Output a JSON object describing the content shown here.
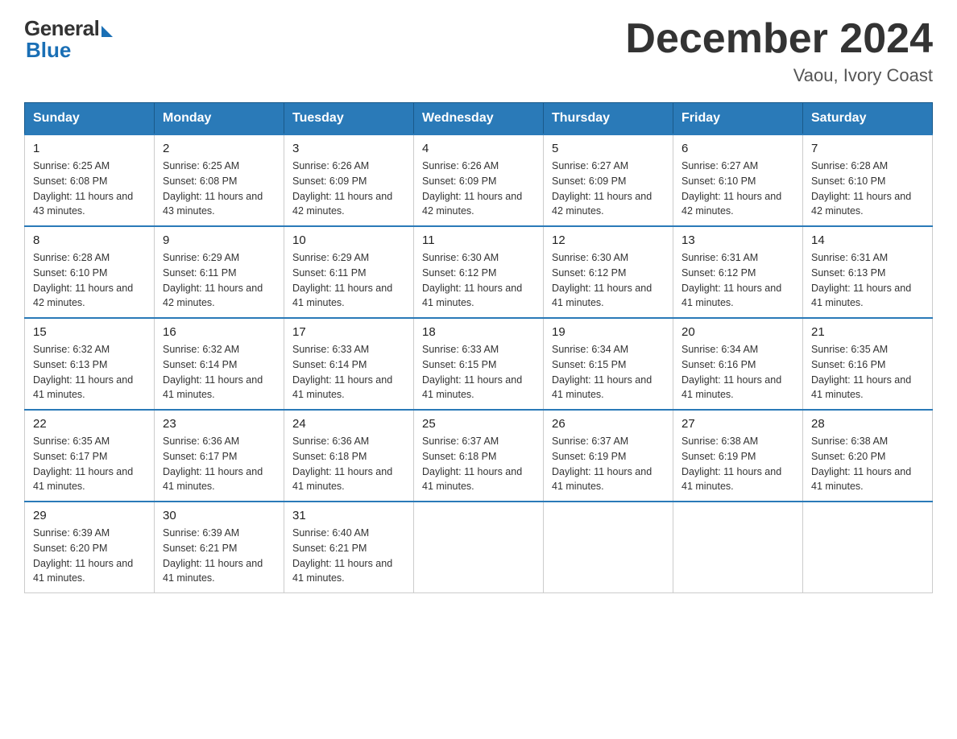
{
  "logo": {
    "general": "General",
    "blue": "Blue"
  },
  "title": "December 2024",
  "subtitle": "Vaou, Ivory Coast",
  "headers": [
    "Sunday",
    "Monday",
    "Tuesday",
    "Wednesday",
    "Thursday",
    "Friday",
    "Saturday"
  ],
  "weeks": [
    [
      {
        "day": "1",
        "sunrise": "6:25 AM",
        "sunset": "6:08 PM",
        "daylight": "11 hours and 43 minutes."
      },
      {
        "day": "2",
        "sunrise": "6:25 AM",
        "sunset": "6:08 PM",
        "daylight": "11 hours and 43 minutes."
      },
      {
        "day": "3",
        "sunrise": "6:26 AM",
        "sunset": "6:09 PM",
        "daylight": "11 hours and 42 minutes."
      },
      {
        "day": "4",
        "sunrise": "6:26 AM",
        "sunset": "6:09 PM",
        "daylight": "11 hours and 42 minutes."
      },
      {
        "day": "5",
        "sunrise": "6:27 AM",
        "sunset": "6:09 PM",
        "daylight": "11 hours and 42 minutes."
      },
      {
        "day": "6",
        "sunrise": "6:27 AM",
        "sunset": "6:10 PM",
        "daylight": "11 hours and 42 minutes."
      },
      {
        "day": "7",
        "sunrise": "6:28 AM",
        "sunset": "6:10 PM",
        "daylight": "11 hours and 42 minutes."
      }
    ],
    [
      {
        "day": "8",
        "sunrise": "6:28 AM",
        "sunset": "6:10 PM",
        "daylight": "11 hours and 42 minutes."
      },
      {
        "day": "9",
        "sunrise": "6:29 AM",
        "sunset": "6:11 PM",
        "daylight": "11 hours and 42 minutes."
      },
      {
        "day": "10",
        "sunrise": "6:29 AM",
        "sunset": "6:11 PM",
        "daylight": "11 hours and 41 minutes."
      },
      {
        "day": "11",
        "sunrise": "6:30 AM",
        "sunset": "6:12 PM",
        "daylight": "11 hours and 41 minutes."
      },
      {
        "day": "12",
        "sunrise": "6:30 AM",
        "sunset": "6:12 PM",
        "daylight": "11 hours and 41 minutes."
      },
      {
        "day": "13",
        "sunrise": "6:31 AM",
        "sunset": "6:12 PM",
        "daylight": "11 hours and 41 minutes."
      },
      {
        "day": "14",
        "sunrise": "6:31 AM",
        "sunset": "6:13 PM",
        "daylight": "11 hours and 41 minutes."
      }
    ],
    [
      {
        "day": "15",
        "sunrise": "6:32 AM",
        "sunset": "6:13 PM",
        "daylight": "11 hours and 41 minutes."
      },
      {
        "day": "16",
        "sunrise": "6:32 AM",
        "sunset": "6:14 PM",
        "daylight": "11 hours and 41 minutes."
      },
      {
        "day": "17",
        "sunrise": "6:33 AM",
        "sunset": "6:14 PM",
        "daylight": "11 hours and 41 minutes."
      },
      {
        "day": "18",
        "sunrise": "6:33 AM",
        "sunset": "6:15 PM",
        "daylight": "11 hours and 41 minutes."
      },
      {
        "day": "19",
        "sunrise": "6:34 AM",
        "sunset": "6:15 PM",
        "daylight": "11 hours and 41 minutes."
      },
      {
        "day": "20",
        "sunrise": "6:34 AM",
        "sunset": "6:16 PM",
        "daylight": "11 hours and 41 minutes."
      },
      {
        "day": "21",
        "sunrise": "6:35 AM",
        "sunset": "6:16 PM",
        "daylight": "11 hours and 41 minutes."
      }
    ],
    [
      {
        "day": "22",
        "sunrise": "6:35 AM",
        "sunset": "6:17 PM",
        "daylight": "11 hours and 41 minutes."
      },
      {
        "day": "23",
        "sunrise": "6:36 AM",
        "sunset": "6:17 PM",
        "daylight": "11 hours and 41 minutes."
      },
      {
        "day": "24",
        "sunrise": "6:36 AM",
        "sunset": "6:18 PM",
        "daylight": "11 hours and 41 minutes."
      },
      {
        "day": "25",
        "sunrise": "6:37 AM",
        "sunset": "6:18 PM",
        "daylight": "11 hours and 41 minutes."
      },
      {
        "day": "26",
        "sunrise": "6:37 AM",
        "sunset": "6:19 PM",
        "daylight": "11 hours and 41 minutes."
      },
      {
        "day": "27",
        "sunrise": "6:38 AM",
        "sunset": "6:19 PM",
        "daylight": "11 hours and 41 minutes."
      },
      {
        "day": "28",
        "sunrise": "6:38 AM",
        "sunset": "6:20 PM",
        "daylight": "11 hours and 41 minutes."
      }
    ],
    [
      {
        "day": "29",
        "sunrise": "6:39 AM",
        "sunset": "6:20 PM",
        "daylight": "11 hours and 41 minutes."
      },
      {
        "day": "30",
        "sunrise": "6:39 AM",
        "sunset": "6:21 PM",
        "daylight": "11 hours and 41 minutes."
      },
      {
        "day": "31",
        "sunrise": "6:40 AM",
        "sunset": "6:21 PM",
        "daylight": "11 hours and 41 minutes."
      },
      null,
      null,
      null,
      null
    ]
  ]
}
